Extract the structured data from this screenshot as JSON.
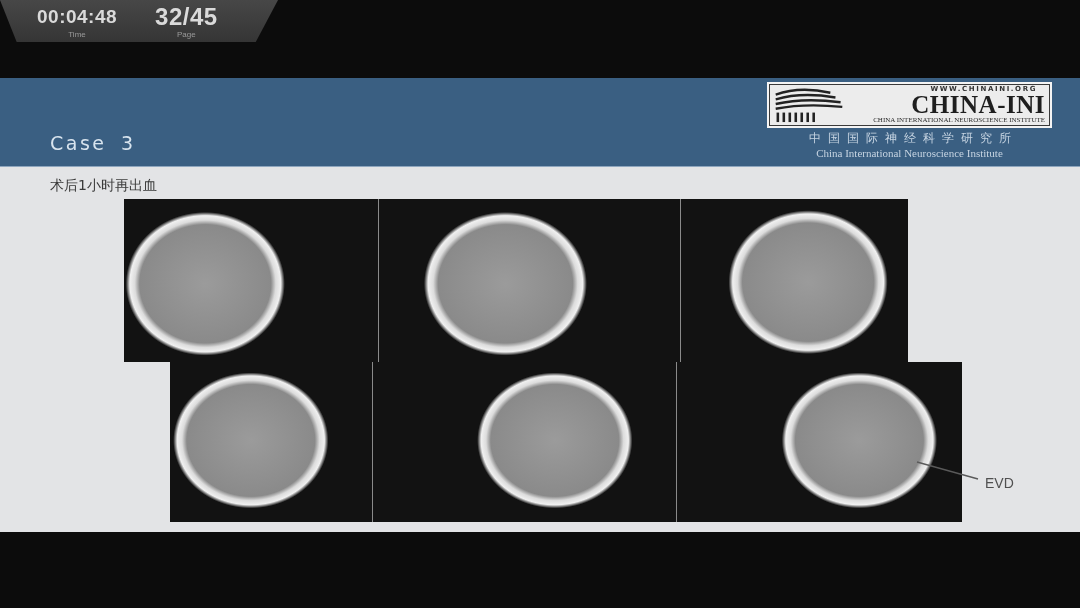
{
  "player_overlay": {
    "elapsed_time": "00:04:48",
    "time_label": "Time",
    "page_counter": "32/45",
    "page_label": "Page"
  },
  "slide": {
    "title": "Case 3",
    "logo": {
      "url": "WWW.CHINAINI.ORG",
      "name": "CHINA-INI",
      "full_name": "CHINA INTERNATIONAL NEUROSCIENCE INSTITUTE"
    },
    "institute_name_zh": "中国国际神经科学研究所",
    "institute_name_en": "China International Neuroscience Institute",
    "subtitle": "术后1小时再出血",
    "annotation": {
      "label": "EVD"
    }
  }
}
